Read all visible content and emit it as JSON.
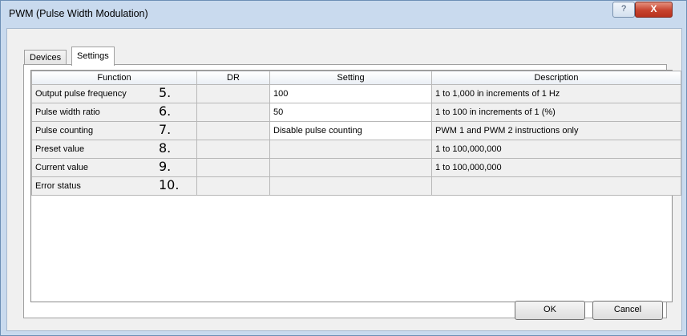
{
  "window": {
    "title": "PWM (Pulse Width Modulation)",
    "help_label": "?",
    "close_label": "X"
  },
  "tabs": [
    {
      "label": "Devices",
      "selected": false
    },
    {
      "label": "Settings",
      "selected": true
    }
  ],
  "grid": {
    "columns": [
      "Function",
      "DR",
      "Setting",
      "Description"
    ],
    "rows": [
      {
        "function": "Output pulse frequency",
        "marker": "5.",
        "dr": "",
        "setting": "100",
        "description": "1 to 1,000 in increments of 1 Hz"
      },
      {
        "function": "Pulse width ratio",
        "marker": "6.",
        "dr": "",
        "setting": "50",
        "description": "1 to 100 in increments of 1 (%)"
      },
      {
        "function": "Pulse counting",
        "marker": "7.",
        "dr": "",
        "setting": "Disable pulse counting",
        "description": "PWM 1 and PWM 2 instructions only"
      },
      {
        "function": "Preset value",
        "marker": "8.",
        "dr": "",
        "setting": "",
        "description": "1 to 100,000,000"
      },
      {
        "function": "Current value",
        "marker": "9.",
        "dr": "",
        "setting": "",
        "description": "1 to 100,000,000"
      },
      {
        "function": "Error status",
        "marker": "10.",
        "dr": "",
        "setting": "",
        "description": ""
      }
    ]
  },
  "buttons": {
    "ok": "OK",
    "cancel": "Cancel"
  },
  "icons": {
    "help": "help-icon",
    "close": "close-icon"
  },
  "colors": {
    "title_bar": "#c9daee",
    "close_button": "#c7432e",
    "dialog_background": "#f0f0f0"
  }
}
